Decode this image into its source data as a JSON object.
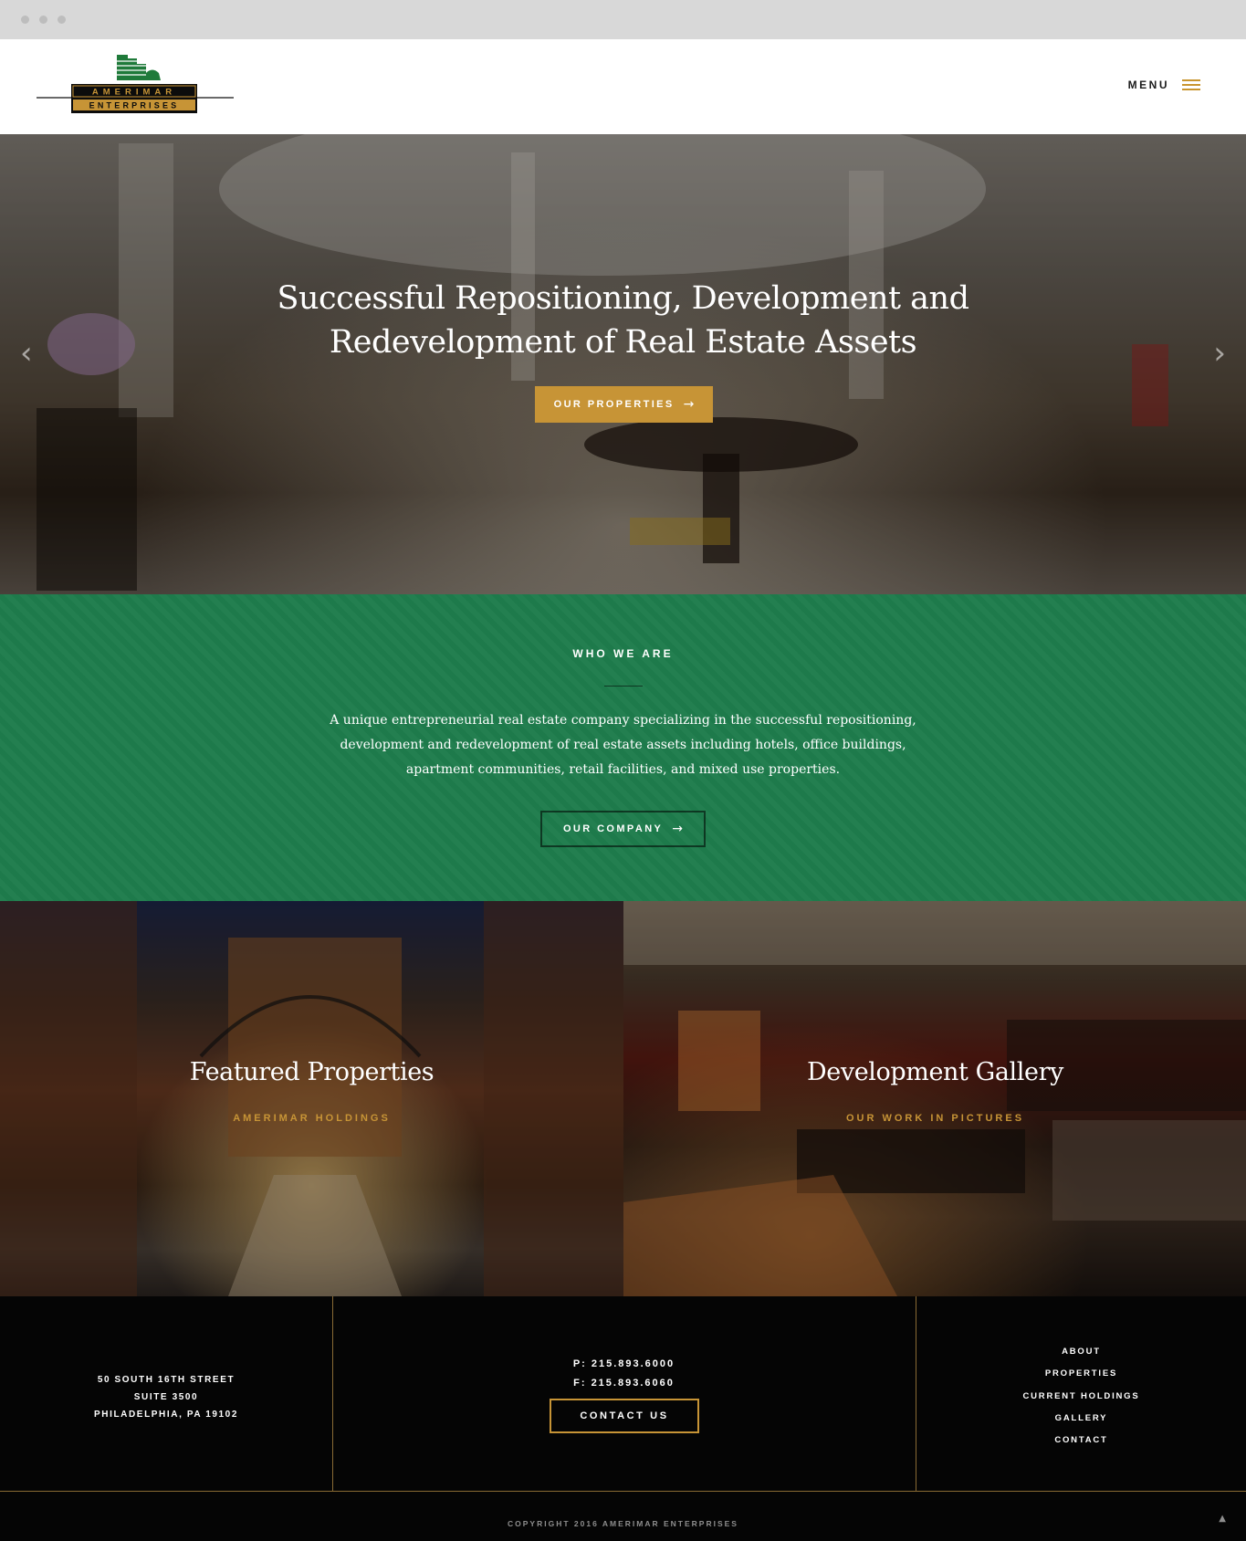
{
  "browser": {
    "window_controls": [
      "dot",
      "dot",
      "dot"
    ]
  },
  "header": {
    "logo": {
      "line1": "AMERIMAR",
      "line2": "ENTERPRISES"
    },
    "menu_label": "MENU",
    "menu_icon": "hamburger-icon"
  },
  "hero": {
    "title_line1": "Successful Repositioning, Development and",
    "title_line2": "Redevelopment of Real Estate Assets",
    "button_label": "OUR PROPERTIES",
    "button_icon": "arrow-right-icon",
    "prev_icon": "chevron-left-icon",
    "next_icon": "chevron-right-icon"
  },
  "who_we_are": {
    "heading": "WHO WE ARE",
    "text": "A unique entrepreneurial real estate company specializing in the successful repositioning, development and redevelopment of real estate assets including hotels, office buildings, apartment communities, retail facilities, and mixed use properties.",
    "button_label": "OUR COMPANY",
    "button_icon": "arrow-right-icon"
  },
  "panels": [
    {
      "title": "Featured Properties",
      "subtitle": "AMERIMAR HOLDINGS"
    },
    {
      "title": "Development Gallery",
      "subtitle": "OUR WORK IN PICTURES"
    }
  ],
  "footer": {
    "address": [
      "50 SOUTH 16TH STREET",
      "SUITE 3500",
      "PHILADELPHIA, PA 19102"
    ],
    "phone": "P: 215.893.6000",
    "fax": "F: 215.893.6060",
    "contact_button": "CONTACT US",
    "nav": [
      "ABOUT",
      "PROPERTIES",
      "CURRENT HOLDINGS",
      "GALLERY",
      "CONTACT"
    ],
    "copyright": "COPYRIGHT 2016 AMERIMAR ENTERPRISES",
    "to_top_icon": "chevron-up-icon"
  },
  "colors": {
    "gold": "#c79436",
    "green": "#1e7c4c",
    "footer_bg": "#050505"
  }
}
